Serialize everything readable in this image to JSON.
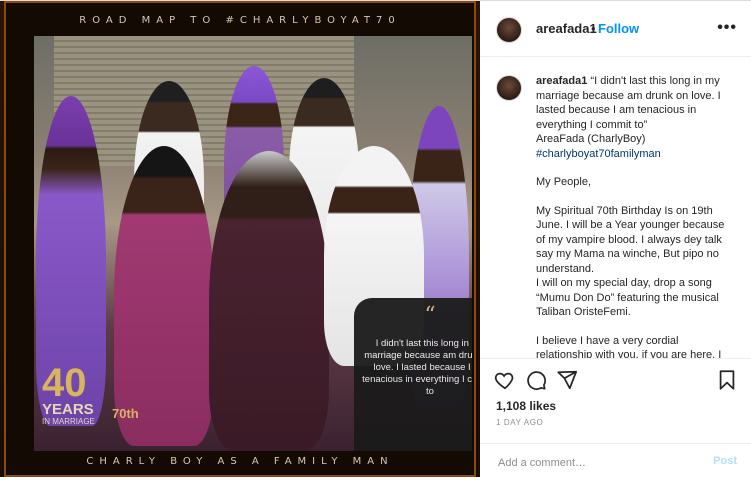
{
  "poster": {
    "top_text": "ROAD MAP TO #CHARLYBOYAT70",
    "bottom_text": "CHARLY BOY AS A FAMILY MAN",
    "quote": "I didn't last this long in my marriage because am drunk on love. I lasted because I am tenacious in everything I commit to",
    "quote_mark": "“",
    "badge_number": "40",
    "badge_years": "YEARS",
    "badge_sub": "IN MARRIAGE",
    "badge_70": "70th"
  },
  "header": {
    "username": "areafada1",
    "dot": "•",
    "follow_label": "Follow",
    "more_icon": "more-options-icon"
  },
  "caption": {
    "username": "areafada1",
    "line1": "“I didn't last this long in my marriage because am drunk on love. I lasted because I am tenacious in everything I commit to”",
    "signature": "AreaFada (CharlyBoy)",
    "hashtag": "#charlyboyat70familyman",
    "greeting": "My People,",
    "para1": "My Spiritual 70th Birthday Is on 19th June. I will be a Year younger because of my vampire blood. I always dey talk say my Mama na winche, But pipo no understand.",
    "para2": "I will on my special day, drop a song “Mumu Don Do” featuring the musical Taliban OristeFemi.",
    "para3": "I believe I have a very cordial relationship with you, if you are here. I"
  },
  "actions": {
    "likes": "1,108 likes",
    "time": "1 DAY AGO",
    "comment_placeholder": "Add a comment…",
    "post_label": "Post"
  },
  "colors": {
    "follow_blue": "#0095f6",
    "hashtag_blue": "#00376b",
    "post_disabled": "#b2dffc",
    "gold": "#d7b45e"
  }
}
